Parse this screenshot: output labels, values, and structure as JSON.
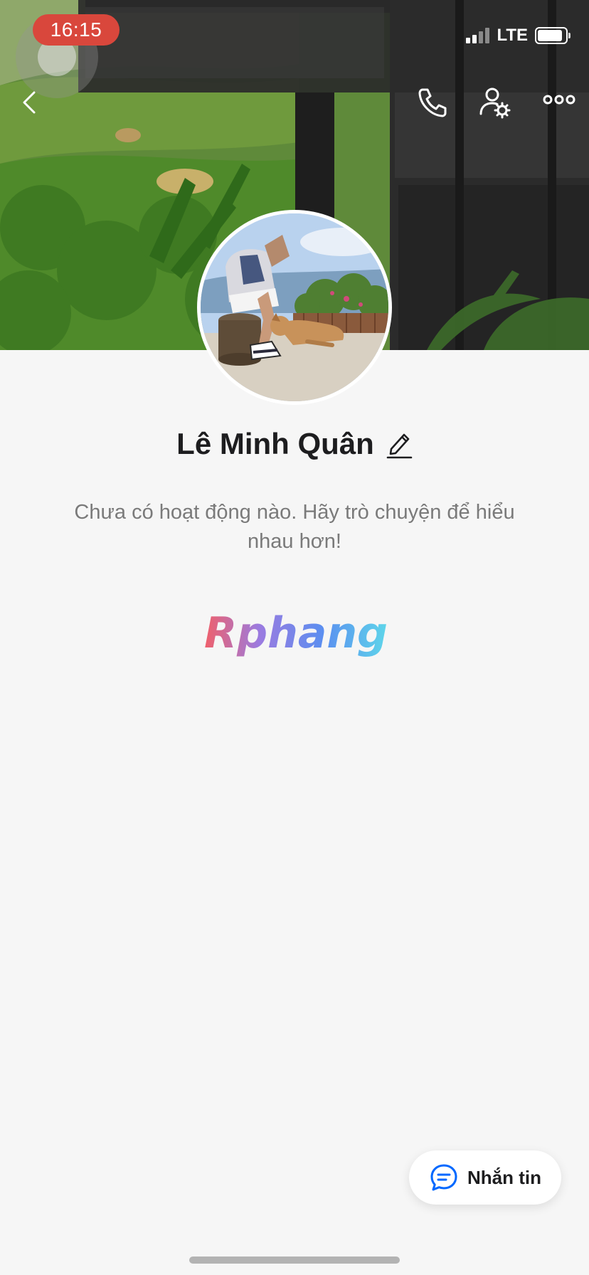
{
  "status_bar": {
    "time": "16:15",
    "network": "LTE",
    "signal_bars_active": 2,
    "signal_bars_total": 4,
    "battery_level": 0.9
  },
  "header": {
    "back_icon": "chevron-left-icon",
    "call_icon": "phone-icon",
    "settings_icon": "user-settings-icon",
    "more_icon": "more-horizontal-icon"
  },
  "profile": {
    "name": "Lê Minh Quân",
    "edit_icon": "pencil-icon",
    "activity_text": "Chưa có hoạt động nào. Hãy trò chuyện để hiểu nhau hơn!"
  },
  "watermark": {
    "text": "Rphang"
  },
  "message_button": {
    "label": "Nhắn tin",
    "icon": "chat-bubble-icon"
  },
  "colors": {
    "time_pill": "#d9473c",
    "background": "#f6f6f6",
    "accent": "#0068ff"
  }
}
